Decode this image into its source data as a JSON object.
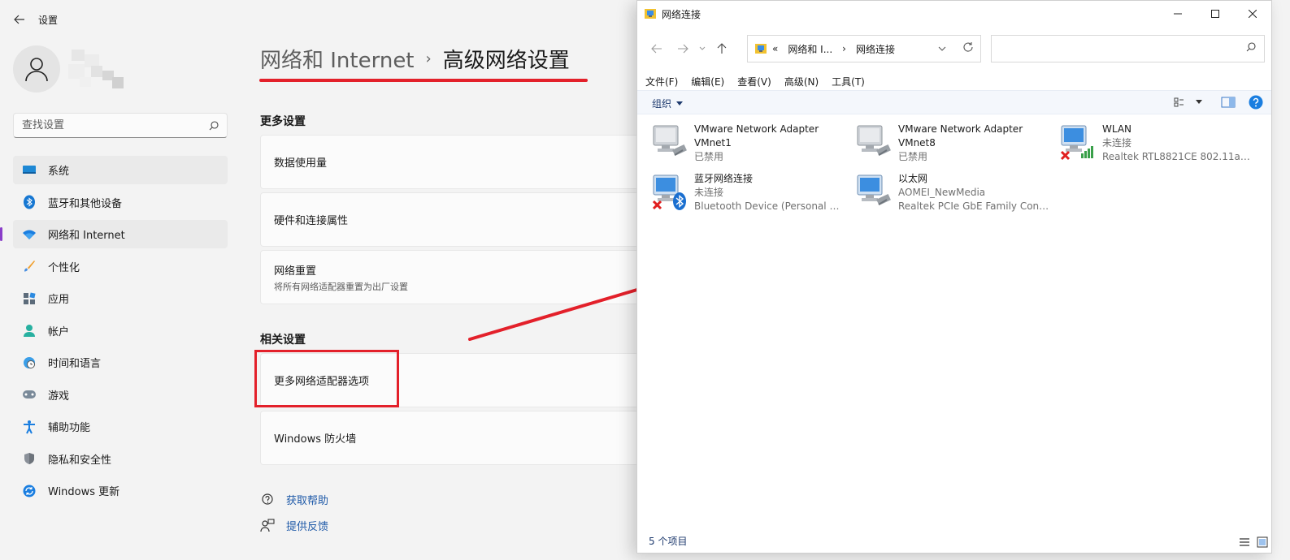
{
  "settings": {
    "app_title": "设置",
    "search_placeholder": "查找设置",
    "nav": [
      {
        "label": "系统",
        "icon": "monitor-icon"
      },
      {
        "label": "蓝牙和其他设备",
        "icon": "bluetooth-icon"
      },
      {
        "label": "网络和 Internet",
        "icon": "wifi-icon"
      },
      {
        "label": "个性化",
        "icon": "brush-icon"
      },
      {
        "label": "应用",
        "icon": "apps-icon"
      },
      {
        "label": "帐户",
        "icon": "person-icon"
      },
      {
        "label": "时间和语言",
        "icon": "globe-clock-icon"
      },
      {
        "label": "游戏",
        "icon": "gamepad-icon"
      },
      {
        "label": "辅助功能",
        "icon": "accessibility-icon"
      },
      {
        "label": "隐私和安全性",
        "icon": "shield-icon"
      },
      {
        "label": "Windows 更新",
        "icon": "update-icon"
      }
    ],
    "breadcrumb": {
      "parent": "网络和 Internet",
      "current": "高级网络设置"
    },
    "more_settings_label": "更多设置",
    "more_settings": [
      {
        "title": "数据使用量",
        "subtitle": ""
      },
      {
        "title": "硬件和连接属性",
        "subtitle": ""
      },
      {
        "title": "网络重置",
        "subtitle": "将所有网络适配器重置为出厂设置"
      }
    ],
    "related_settings_label": "相关设置",
    "related_settings": [
      {
        "title": "更多网络适配器选项"
      },
      {
        "title": "Windows 防火墙"
      }
    ],
    "help": {
      "get_help": "获取帮助",
      "feedback": "提供反馈"
    }
  },
  "explorer": {
    "title": "网络连接",
    "address": {
      "prefix": "«",
      "part1": "网络和 I...",
      "sep": "›",
      "part2": "网络连接"
    },
    "menu": [
      "文件(F)",
      "编辑(E)",
      "查看(V)",
      "高级(N)",
      "工具(T)"
    ],
    "organize_label": "组织",
    "adapters": [
      {
        "name": "VMware Network Adapter VMnet1",
        "name_line1": "VMware Network Adapter",
        "name_line2": "VMnet1",
        "status": "已禁用",
        "desc": ""
      },
      {
        "name": "VMware Network Adapter VMnet8",
        "name_line1": "VMware Network Adapter",
        "name_line2": "VMnet8",
        "status": "已禁用",
        "desc": ""
      },
      {
        "name": "WLAN",
        "name_line1": "WLAN",
        "name_line2": "",
        "status": "未连接",
        "desc": "Realtek RTL8821CE 802.11ac P..."
      },
      {
        "name": "蓝牙网络连接",
        "name_line1": "蓝牙网络连接",
        "name_line2": "",
        "status": "未连接",
        "desc": "Bluetooth Device (Personal Ar..."
      },
      {
        "name": "以太网",
        "name_line1": "以太网",
        "name_line2": "",
        "status": "AOMEI_NewMedia",
        "desc": "Realtek PCIe GbE Family Contr..."
      }
    ],
    "status_count": "5 个项目"
  },
  "colors": {
    "annotation_red": "#e3202a",
    "accent_purple": "#8a3ec9",
    "link_blue": "#1f5aa8"
  }
}
